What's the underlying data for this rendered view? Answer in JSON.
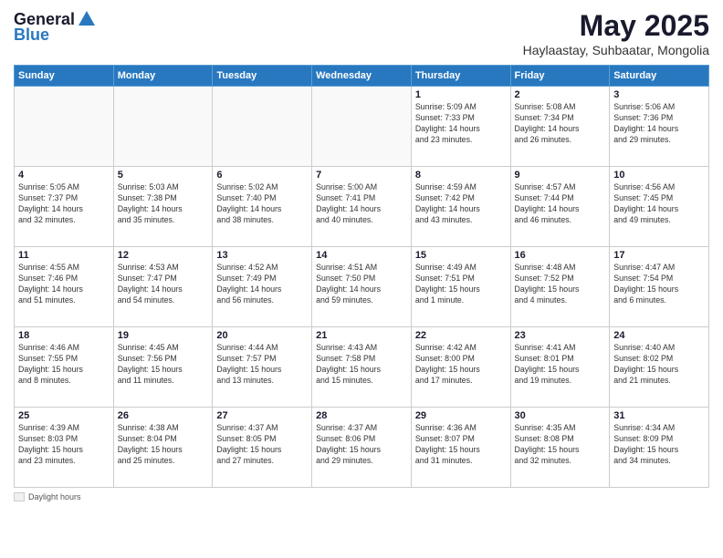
{
  "header": {
    "logo_general": "General",
    "logo_blue": "Blue",
    "month_title": "May 2025",
    "subtitle": "Haylaastay, Suhbaatar, Mongolia"
  },
  "weekdays": [
    "Sunday",
    "Monday",
    "Tuesday",
    "Wednesday",
    "Thursday",
    "Friday",
    "Saturday"
  ],
  "weeks": [
    [
      {
        "day": "",
        "info": ""
      },
      {
        "day": "",
        "info": ""
      },
      {
        "day": "",
        "info": ""
      },
      {
        "day": "",
        "info": ""
      },
      {
        "day": "1",
        "info": "Sunrise: 5:09 AM\nSunset: 7:33 PM\nDaylight: 14 hours\nand 23 minutes."
      },
      {
        "day": "2",
        "info": "Sunrise: 5:08 AM\nSunset: 7:34 PM\nDaylight: 14 hours\nand 26 minutes."
      },
      {
        "day": "3",
        "info": "Sunrise: 5:06 AM\nSunset: 7:36 PM\nDaylight: 14 hours\nand 29 minutes."
      }
    ],
    [
      {
        "day": "4",
        "info": "Sunrise: 5:05 AM\nSunset: 7:37 PM\nDaylight: 14 hours\nand 32 minutes."
      },
      {
        "day": "5",
        "info": "Sunrise: 5:03 AM\nSunset: 7:38 PM\nDaylight: 14 hours\nand 35 minutes."
      },
      {
        "day": "6",
        "info": "Sunrise: 5:02 AM\nSunset: 7:40 PM\nDaylight: 14 hours\nand 38 minutes."
      },
      {
        "day": "7",
        "info": "Sunrise: 5:00 AM\nSunset: 7:41 PM\nDaylight: 14 hours\nand 40 minutes."
      },
      {
        "day": "8",
        "info": "Sunrise: 4:59 AM\nSunset: 7:42 PM\nDaylight: 14 hours\nand 43 minutes."
      },
      {
        "day": "9",
        "info": "Sunrise: 4:57 AM\nSunset: 7:44 PM\nDaylight: 14 hours\nand 46 minutes."
      },
      {
        "day": "10",
        "info": "Sunrise: 4:56 AM\nSunset: 7:45 PM\nDaylight: 14 hours\nand 49 minutes."
      }
    ],
    [
      {
        "day": "11",
        "info": "Sunrise: 4:55 AM\nSunset: 7:46 PM\nDaylight: 14 hours\nand 51 minutes."
      },
      {
        "day": "12",
        "info": "Sunrise: 4:53 AM\nSunset: 7:47 PM\nDaylight: 14 hours\nand 54 minutes."
      },
      {
        "day": "13",
        "info": "Sunrise: 4:52 AM\nSunset: 7:49 PM\nDaylight: 14 hours\nand 56 minutes."
      },
      {
        "day": "14",
        "info": "Sunrise: 4:51 AM\nSunset: 7:50 PM\nDaylight: 14 hours\nand 59 minutes."
      },
      {
        "day": "15",
        "info": "Sunrise: 4:49 AM\nSunset: 7:51 PM\nDaylight: 15 hours\nand 1 minute."
      },
      {
        "day": "16",
        "info": "Sunrise: 4:48 AM\nSunset: 7:52 PM\nDaylight: 15 hours\nand 4 minutes."
      },
      {
        "day": "17",
        "info": "Sunrise: 4:47 AM\nSunset: 7:54 PM\nDaylight: 15 hours\nand 6 minutes."
      }
    ],
    [
      {
        "day": "18",
        "info": "Sunrise: 4:46 AM\nSunset: 7:55 PM\nDaylight: 15 hours\nand 8 minutes."
      },
      {
        "day": "19",
        "info": "Sunrise: 4:45 AM\nSunset: 7:56 PM\nDaylight: 15 hours\nand 11 minutes."
      },
      {
        "day": "20",
        "info": "Sunrise: 4:44 AM\nSunset: 7:57 PM\nDaylight: 15 hours\nand 13 minutes."
      },
      {
        "day": "21",
        "info": "Sunrise: 4:43 AM\nSunset: 7:58 PM\nDaylight: 15 hours\nand 15 minutes."
      },
      {
        "day": "22",
        "info": "Sunrise: 4:42 AM\nSunset: 8:00 PM\nDaylight: 15 hours\nand 17 minutes."
      },
      {
        "day": "23",
        "info": "Sunrise: 4:41 AM\nSunset: 8:01 PM\nDaylight: 15 hours\nand 19 minutes."
      },
      {
        "day": "24",
        "info": "Sunrise: 4:40 AM\nSunset: 8:02 PM\nDaylight: 15 hours\nand 21 minutes."
      }
    ],
    [
      {
        "day": "25",
        "info": "Sunrise: 4:39 AM\nSunset: 8:03 PM\nDaylight: 15 hours\nand 23 minutes."
      },
      {
        "day": "26",
        "info": "Sunrise: 4:38 AM\nSunset: 8:04 PM\nDaylight: 15 hours\nand 25 minutes."
      },
      {
        "day": "27",
        "info": "Sunrise: 4:37 AM\nSunset: 8:05 PM\nDaylight: 15 hours\nand 27 minutes."
      },
      {
        "day": "28",
        "info": "Sunrise: 4:37 AM\nSunset: 8:06 PM\nDaylight: 15 hours\nand 29 minutes."
      },
      {
        "day": "29",
        "info": "Sunrise: 4:36 AM\nSunset: 8:07 PM\nDaylight: 15 hours\nand 31 minutes."
      },
      {
        "day": "30",
        "info": "Sunrise: 4:35 AM\nSunset: 8:08 PM\nDaylight: 15 hours\nand 32 minutes."
      },
      {
        "day": "31",
        "info": "Sunrise: 4:34 AM\nSunset: 8:09 PM\nDaylight: 15 hours\nand 34 minutes."
      }
    ]
  ],
  "footer": {
    "daylight_label": "Daylight hours"
  }
}
